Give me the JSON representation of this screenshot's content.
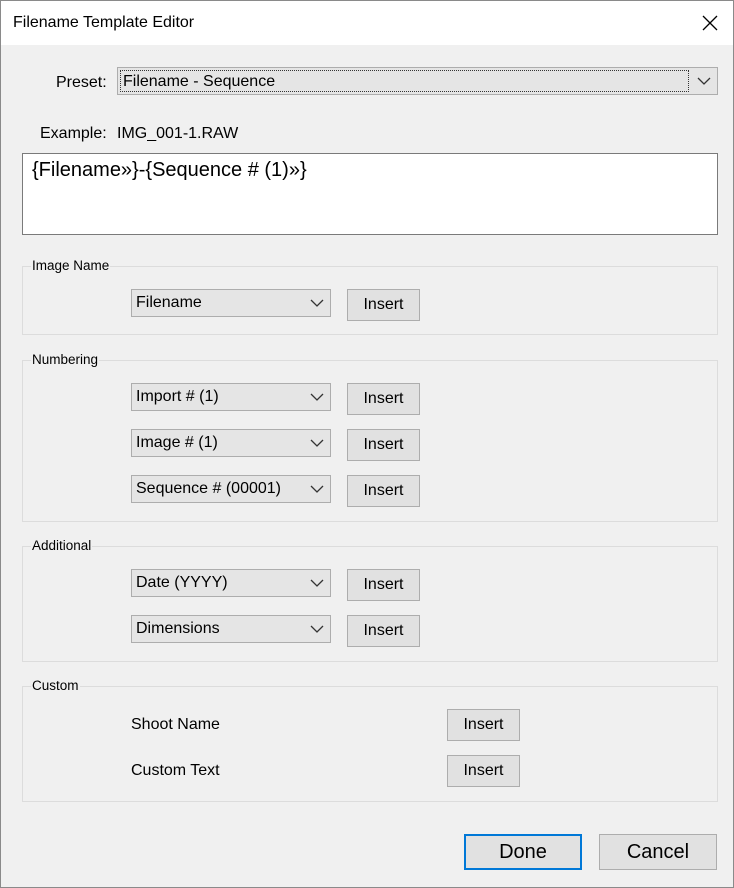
{
  "window": {
    "title": "Filename Template Editor"
  },
  "preset": {
    "label": "Preset:",
    "value": "Filename - Sequence"
  },
  "example": {
    "label": "Example:",
    "value": "IMG_001-1.RAW"
  },
  "template": {
    "text": "{Filename»}-{Sequence # (1)»}"
  },
  "groups": {
    "image_name": {
      "title": "Image Name",
      "rows": [
        {
          "dropdown": "Filename",
          "button": "Insert"
        }
      ]
    },
    "numbering": {
      "title": "Numbering",
      "rows": [
        {
          "dropdown": "Import # (1)",
          "button": "Insert"
        },
        {
          "dropdown": "Image # (1)",
          "button": "Insert"
        },
        {
          "dropdown": "Sequence # (00001)",
          "button": "Insert"
        }
      ]
    },
    "additional": {
      "title": "Additional",
      "rows": [
        {
          "dropdown": "Date (YYYY)",
          "button": "Insert"
        },
        {
          "dropdown": "Dimensions",
          "button": "Insert"
        }
      ]
    },
    "custom": {
      "title": "Custom",
      "rows": [
        {
          "label": "Shoot Name",
          "button": "Insert"
        },
        {
          "label": "Custom Text",
          "button": "Insert"
        }
      ]
    }
  },
  "footer": {
    "done": "Done",
    "cancel": "Cancel"
  },
  "icons": {
    "close": "close-icon",
    "dropdown": "chevron-down-icon"
  },
  "colors": {
    "accent": "#0078d7",
    "titlebar": "#ffffff",
    "dialog_bg": "#f0f0f0"
  }
}
